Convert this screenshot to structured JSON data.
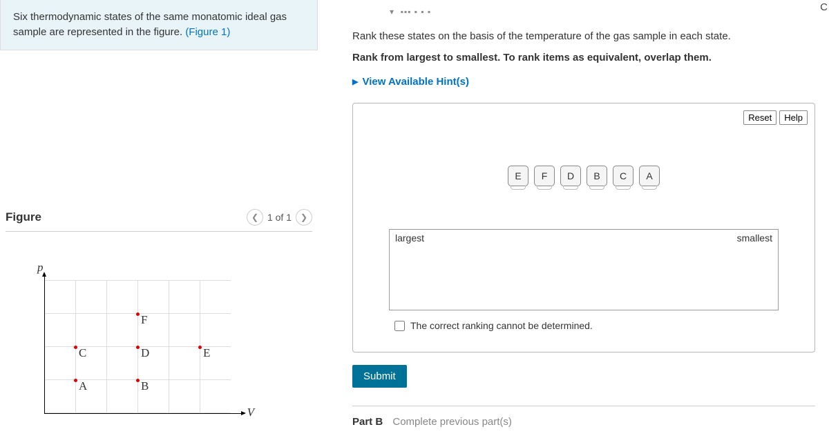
{
  "intro": {
    "text_a": "Six thermodynamic states of the same monatomic ideal gas sample are represented in the figure. ",
    "link": "(Figure 1)"
  },
  "figure": {
    "title": "Figure",
    "page": "1 of 1",
    "p_axis": "p",
    "v_axis": "V"
  },
  "chart_data": {
    "type": "scatter",
    "xlabel": "V",
    "ylabel": "p",
    "series": [
      {
        "name": "A",
        "x": 1,
        "y": 1
      },
      {
        "name": "B",
        "x": 3,
        "y": 1
      },
      {
        "name": "C",
        "x": 1,
        "y": 2
      },
      {
        "name": "D",
        "x": 3,
        "y": 2
      },
      {
        "name": "E",
        "x": 5,
        "y": 2
      },
      {
        "name": "F",
        "x": 3,
        "y": 3
      }
    ]
  },
  "question": {
    "line1": "Rank these states on the basis of the temperature of the gas sample in each state.",
    "line2": "Rank from largest to smallest. To rank items as equivalent, overlap them.",
    "hints": "View Available Hint(s)"
  },
  "rank": {
    "reset": "Reset",
    "help": "Help",
    "chips": [
      "E",
      "F",
      "D",
      "B",
      "C",
      "A"
    ],
    "largest": "largest",
    "smallest": "smallest",
    "cannot": "The correct ranking cannot be determined."
  },
  "buttons": {
    "submit": "Submit"
  },
  "partb": {
    "label": "Part B",
    "msg": "Complete previous part(s)"
  },
  "corner": "C"
}
